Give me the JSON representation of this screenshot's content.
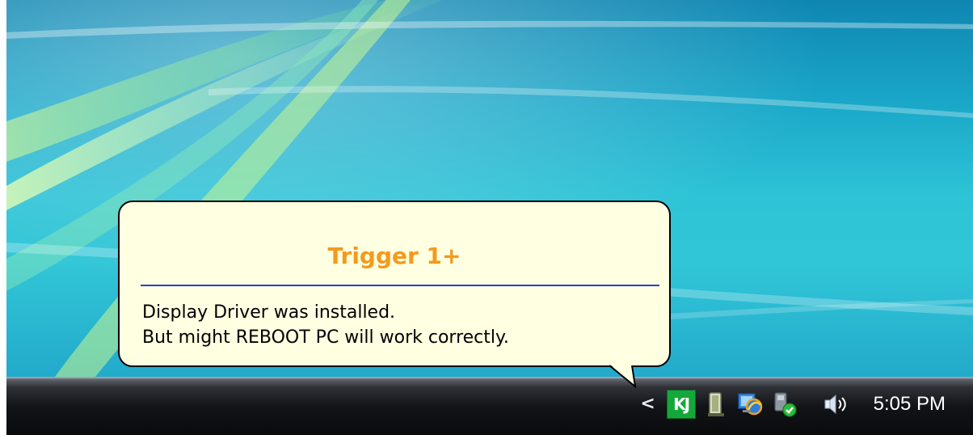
{
  "notification": {
    "title": "Trigger 1+",
    "message_lines": [
      "Display Driver was installed.",
      "But might REBOOT PC will work correctly."
    ]
  },
  "tray": {
    "overflow_arrow": "<",
    "icons": [
      "kj-app-icon",
      "device-icon",
      "network-globe-icon",
      "safely-remove-hardware-icon",
      "speaker-volume-icon"
    ],
    "app_icon_text": "KJ",
    "clock": "5:05 PM"
  },
  "colors": {
    "balloon_background": "#ffffe1",
    "title": "#f39a1c",
    "rule": "#2b3fd1",
    "app_icon": "#14a83a"
  }
}
